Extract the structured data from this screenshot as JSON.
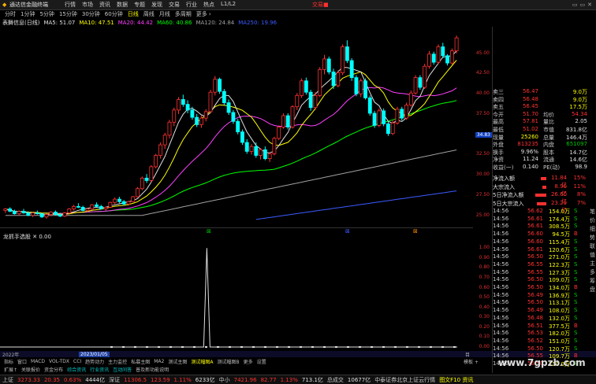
{
  "menubar": {
    "app_title": "通达信金融终端",
    "items": [
      "行情",
      "市场",
      "资讯",
      "数据",
      "专题",
      "发现",
      "交易",
      "行业",
      "热点",
      "L1/L2"
    ],
    "brand": "交易■",
    "window_controls": "▭▭✕"
  },
  "periods": {
    "items": [
      "分时",
      "1分钟",
      "5分钟",
      "15分钟",
      "30分钟",
      "60分钟",
      "日线",
      "周线",
      "月线",
      "多周期",
      "更多 ›"
    ],
    "active_index": 6
  },
  "indicators": {
    "stock_label": "表舞信息(日线)",
    "items": [
      {
        "label": "MA5: 51.07",
        "color": "#e0e0e0"
      },
      {
        "label": "MA10: 47.51",
        "color": "#ffff00"
      },
      {
        "label": "MA20: 44.42",
        "color": "#ff40ff"
      },
      {
        "label": "MA60: 40.86",
        "color": "#00ff00"
      },
      {
        "label": "MA120: 24.84",
        "color": "#a0a0a0"
      },
      {
        "label": "MA250: 19.96",
        "color": "#3b5bff"
      }
    ]
  },
  "price_axis": {
    "labels": [
      "45.00",
      "42.50",
      "40.00",
      "37.50",
      "34.83",
      "32.50",
      "30.00",
      "27.50",
      "25.00"
    ],
    "current_price": "34.83",
    "ylim": [
      24.0,
      47.5
    ]
  },
  "markers": [
    "⊠",
    "⊠",
    "⊠"
  ],
  "sub_panel": {
    "title": "龙抓手选股 ✕ 0.00",
    "axis_labels": [
      "1.00",
      "0.90",
      "0.80",
      "0.70",
      "0.60",
      "0.50",
      "0.40",
      "0.30",
      "0.20",
      "0.10",
      "0.00"
    ]
  },
  "datebar": {
    "left_date": "2022年",
    "cursor_date": "2023/01/05",
    "right": "目"
  },
  "tabs": {
    "items": [
      "指标",
      "窗口",
      "MACD",
      "VOL-TDX",
      "CCI",
      "趋势动力",
      "主力监控",
      "私募主图",
      "MA2",
      "测试主图",
      "测试幅图A",
      "测试幅图B",
      "更多",
      "设置"
    ],
    "active_index": 10,
    "right_label": "模板 +"
  },
  "tabs2": {
    "items": [
      "扩展↑",
      "关联报价",
      "资金分布",
      "综合资讯",
      "行业资讯",
      "互动问答",
      "普及新功能说明"
    ]
  },
  "statusbar": {
    "items": [
      {
        "label": "上证",
        "color": "#c8c8c8"
      },
      {
        "label": "3273.33",
        "color": "#ff3232"
      },
      {
        "label": "20.35",
        "color": "#ff3232"
      },
      {
        "label": "0.63%",
        "color": "#ff3232"
      },
      {
        "label": "4444亿",
        "color": "#e0e0e0"
      },
      {
        "label": "深证",
        "color": "#c8c8c8"
      },
      {
        "label": "11306.5",
        "color": "#ff3232"
      },
      {
        "label": "123.59",
        "color": "#ff3232"
      },
      {
        "label": "1.11%",
        "color": "#ff3232"
      },
      {
        "label": "6233亿",
        "color": "#e0e0e0"
      },
      {
        "label": "中小",
        "color": "#c8c8c8"
      },
      {
        "label": "7421.96",
        "color": "#ff3232"
      },
      {
        "label": "82.77",
        "color": "#ff3232"
      },
      {
        "label": "1.13%",
        "color": "#ff3232"
      },
      {
        "label": "713.1亿",
        "color": "#e0e0e0"
      },
      {
        "label": "总成交",
        "color": "#c8c8c8"
      },
      {
        "label": "10677亿",
        "color": "#e0e0e0"
      },
      {
        "label": "中泰证券北京上证云行情",
        "color": "#c8c8c8"
      },
      {
        "label": "图文F10 资讯",
        "color": "#ffff00"
      }
    ]
  },
  "quote": {
    "rows": [
      {
        "l": "卖三",
        "v": "56.47",
        "vc": "#ff3232",
        "l2": "",
        "v2": "9.0万",
        "v2c": "#ffff00"
      },
      {
        "l": "卖四",
        "v": "56.48",
        "vc": "#ff3232",
        "l2": "",
        "v2": "9.0万",
        "v2c": "#ffff00"
      },
      {
        "l": "卖五",
        "v": "56.45",
        "vc": "#ff3232",
        "l2": "",
        "v2": "17.5万",
        "v2c": "#ffff00"
      },
      {
        "l": "今开",
        "v": "51.70",
        "vc": "#ff3232",
        "l2": "均价",
        "v2": "54.34",
        "v2c": "#ff3232"
      },
      {
        "l": "最高",
        "v": "57.81",
        "vc": "#ff3232",
        "l2": "量比",
        "v2": "2.05",
        "v2c": "#e0e0e0"
      },
      {
        "l": "最低",
        "v": "51.02",
        "vc": "#ff3232",
        "l2": "市值",
        "v2": "831.8亿",
        "v2c": "#e0e0e0"
      },
      {
        "l": "现量",
        "v": "25260",
        "vc": "#ffff00",
        "l2": "总量",
        "v2": "146.4万",
        "v2c": "#e0e0e0"
      },
      {
        "l": "外盘",
        "v": "813235",
        "vc": "#ff3232",
        "l2": "内盘",
        "v2": "651097",
        "v2c": "#00c800"
      },
      {
        "l": "换手",
        "v": "9.96%",
        "vc": "#e0e0e0",
        "l2": "股本",
        "v2": "14.7亿",
        "v2c": "#e0e0e0"
      },
      {
        "l": "净资",
        "v": "11.24",
        "vc": "#e0e0e0",
        "l2": "流通",
        "v2": "14.6亿",
        "v2c": "#e0e0e0"
      },
      {
        "l": "收益(一)",
        "v": "0.140",
        "vc": "#e0e0e0",
        "l2": "PE(动)",
        "v2": "98.9",
        "v2c": "#e0e0e0"
      }
    ]
  },
  "flow": {
    "rows": [
      {
        "label": "净流入额",
        "value": "11.84亿",
        "pct": "15%",
        "bar": 0.35
      },
      {
        "label": "大宗流入",
        "value": "8.96亿",
        "pct": "11%",
        "bar": 0.25
      },
      {
        "label": "5日净流入额",
        "value": "26.60亿",
        "pct": "8%",
        "bar": 0.7
      },
      {
        "label": "5日大宗流入",
        "value": "23.29亿",
        "pct": "7%",
        "bar": 0.6
      }
    ]
  },
  "ticks": [
    {
      "t": "14:56",
      "p": "56.62",
      "v": "154.0万",
      "f": "S"
    },
    {
      "t": "14:56",
      "p": "56.61",
      "v": "174.4万",
      "f": "S"
    },
    {
      "t": "14:56",
      "p": "56.61",
      "v": "308.5万",
      "f": "S"
    },
    {
      "t": "14:56",
      "p": "56.60",
      "v": "94.5万",
      "f": "B"
    },
    {
      "t": "14:56",
      "p": "56.60",
      "v": "115.4万",
      "f": "S"
    },
    {
      "t": "14:56",
      "p": "56.61",
      "v": "120.6万",
      "f": "S"
    },
    {
      "t": "14:56",
      "p": "56.50",
      "v": "271.0万",
      "f": "S"
    },
    {
      "t": "14:56",
      "p": "56.55",
      "v": "122.3万",
      "f": "S"
    },
    {
      "t": "14:56",
      "p": "56.55",
      "v": "127.3万",
      "f": "S"
    },
    {
      "t": "14:56",
      "p": "56.50",
      "v": "109.0万",
      "f": "S"
    },
    {
      "t": "14:56",
      "p": "56.50",
      "v": "134.0万",
      "f": "B"
    },
    {
      "t": "14:56",
      "p": "56.49",
      "v": "136.9万",
      "f": "S"
    },
    {
      "t": "14:56",
      "p": "56.50",
      "v": "113.1万",
      "f": "S"
    },
    {
      "t": "14:56",
      "p": "56.49",
      "v": "108.0万",
      "f": "S"
    },
    {
      "t": "14:56",
      "p": "56.48",
      "v": "132.0万",
      "f": "S"
    },
    {
      "t": "14:56",
      "p": "56.51",
      "v": "377.5万",
      "f": "B"
    },
    {
      "t": "14:56",
      "p": "56.53",
      "v": "182.0万",
      "f": "S"
    },
    {
      "t": "14:56",
      "p": "56.52",
      "v": "151.0万",
      "f": "S"
    },
    {
      "t": "14:56",
      "p": "56.50",
      "v": "120.7万",
      "f": "S"
    },
    {
      "t": "14:56",
      "p": "56.55",
      "v": "109.7万",
      "f": "B"
    },
    {
      "t": "14:56",
      "p": "56.50",
      "v": "110.0万",
      "f": "S"
    }
  ],
  "sidetabs": [
    "笔",
    "价",
    "细",
    "势",
    "联",
    "值",
    "主",
    "多",
    "筹",
    "盘"
  ],
  "watermark": "www.7gpzb.com",
  "chart_data": {
    "type": "candlestick",
    "ylim": [
      24.0,
      47.5
    ],
    "candles": [
      [
        25.6,
        25.9,
        25.3,
        25.8
      ],
      [
        25.8,
        26.0,
        25.4,
        25.5
      ],
      [
        25.5,
        25.7,
        25.1,
        25.2
      ],
      [
        25.2,
        25.6,
        25.0,
        25.5
      ],
      [
        25.5,
        25.8,
        25.2,
        25.3
      ],
      [
        25.3,
        25.5,
        24.9,
        25.0
      ],
      [
        25.0,
        25.4,
        24.8,
        25.3
      ],
      [
        25.3,
        25.6,
        25.1,
        25.2
      ],
      [
        25.2,
        25.3,
        24.7,
        24.8
      ],
      [
        24.8,
        25.2,
        24.6,
        25.1
      ],
      [
        25.1,
        25.5,
        24.9,
        25.4
      ],
      [
        25.4,
        25.6,
        25.0,
        25.1
      ],
      [
        25.1,
        25.3,
        24.8,
        24.9
      ],
      [
        24.9,
        25.4,
        24.8,
        25.3
      ],
      [
        25.3,
        25.9,
        25.2,
        25.8
      ],
      [
        25.8,
        26.3,
        25.6,
        26.1
      ],
      [
        26.1,
        26.5,
        25.9,
        26.0
      ],
      [
        26.0,
        26.2,
        25.5,
        25.6
      ],
      [
        25.6,
        25.9,
        25.4,
        25.8
      ],
      [
        25.8,
        26.4,
        25.7,
        26.3
      ],
      [
        26.3,
        26.6,
        26.0,
        26.1
      ],
      [
        26.1,
        26.3,
        25.7,
        25.8
      ],
      [
        25.8,
        26.1,
        25.6,
        26.0
      ],
      [
        26.0,
        26.7,
        25.9,
        26.6
      ],
      [
        26.6,
        27.2,
        26.4,
        27.0
      ],
      [
        27.0,
        27.3,
        26.5,
        26.7
      ],
      [
        26.7,
        26.9,
        26.2,
        26.4
      ],
      [
        26.4,
        26.8,
        26.2,
        26.7
      ],
      [
        26.7,
        27.4,
        26.6,
        27.3
      ],
      [
        27.3,
        28.5,
        27.2,
        28.3
      ],
      [
        28.3,
        29.8,
        28.1,
        29.6
      ],
      [
        29.6,
        30.1,
        29.0,
        29.3
      ],
      [
        29.3,
        31.2,
        29.1,
        31.0
      ],
      [
        31.0,
        32.6,
        30.8,
        32.4
      ],
      [
        32.4,
        34.0,
        32.0,
        33.7
      ],
      [
        33.7,
        35.2,
        33.2,
        34.9
      ],
      [
        34.9,
        36.8,
        34.5,
        36.5
      ],
      [
        36.5,
        38.3,
        36.0,
        38.0
      ],
      [
        38.0,
        39.6,
        37.5,
        39.3
      ],
      [
        39.3,
        39.9,
        38.4,
        38.7
      ],
      [
        38.7,
        39.2,
        37.6,
        38.0
      ],
      [
        38.0,
        38.4,
        36.8,
        37.1
      ],
      [
        37.1,
        37.5,
        35.9,
        36.2
      ],
      [
        36.2,
        37.3,
        35.8,
        37.0
      ],
      [
        37.0,
        38.1,
        36.6,
        37.8
      ],
      [
        37.8,
        40.5,
        37.6,
        40.2
      ],
      [
        40.2,
        42.2,
        39.8,
        41.8
      ],
      [
        41.8,
        42.0,
        40.0,
        40.3
      ],
      [
        40.3,
        40.6,
        38.6,
        38.9
      ],
      [
        38.9,
        39.3,
        37.4,
        37.7
      ],
      [
        37.7,
        38.0,
        36.3,
        36.6
      ],
      [
        36.6,
        36.9,
        35.0,
        35.3
      ],
      [
        35.3,
        35.6,
        33.7,
        34.0
      ],
      [
        34.0,
        34.4,
        32.6,
        32.9
      ],
      [
        32.9,
        33.8,
        32.5,
        33.5
      ],
      [
        33.5,
        34.0,
        32.1,
        32.4
      ],
      [
        32.4,
        33.3,
        31.9,
        33.1
      ],
      [
        33.1,
        33.5,
        31.8,
        32.0
      ],
      [
        32.0,
        32.8,
        31.6,
        32.6
      ],
      [
        32.6,
        34.7,
        32.4,
        34.5
      ],
      [
        34.5,
        36.1,
        34.3,
        35.9
      ],
      [
        35.9,
        37.6,
        35.7,
        37.3
      ],
      [
        37.3,
        37.6,
        35.6,
        35.9
      ],
      [
        35.9,
        38.6,
        35.7,
        38.4
      ],
      [
        38.4,
        40.1,
        38.0,
        39.8
      ],
      [
        39.8,
        41.9,
        39.5,
        41.6
      ],
      [
        41.6,
        42.0,
        39.9,
        40.2
      ],
      [
        40.2,
        40.5,
        37.9,
        38.3
      ],
      [
        38.3,
        40.2,
        38.0,
        39.8
      ],
      [
        39.8,
        43.3,
        39.6,
        43.0
      ],
      [
        43.0,
        44.8,
        42.4,
        44.3
      ],
      [
        44.3,
        44.6,
        42.4,
        42.7
      ],
      [
        42.7,
        43.1,
        40.6,
        41.0
      ],
      [
        41.0,
        42.9,
        40.8,
        42.6
      ],
      [
        42.6,
        46.1,
        42.3,
        45.8
      ],
      [
        45.8,
        46.6,
        43.8,
        44.1
      ],
      [
        44.1,
        44.4,
        41.6,
        42.0
      ],
      [
        42.0,
        42.3,
        39.7,
        40.0
      ],
      [
        40.0,
        41.9,
        39.6,
        41.6
      ],
      [
        41.6,
        41.9,
        39.3,
        39.5
      ],
      [
        39.5,
        39.8,
        37.3,
        37.6
      ],
      [
        37.6,
        37.9,
        35.8,
        36.1
      ],
      [
        36.1,
        38.2,
        35.9,
        37.9
      ],
      [
        37.9,
        38.2,
        36.0,
        36.3
      ],
      [
        36.3,
        36.6,
        34.8,
        35.1
      ],
      [
        35.1,
        36.7,
        34.9,
        36.4
      ],
      [
        36.4,
        38.4,
        36.2,
        38.1
      ],
      [
        38.1,
        38.4,
        36.7,
        37.0
      ],
      [
        37.0,
        38.9,
        36.8,
        38.6
      ],
      [
        38.6,
        40.4,
        38.4,
        40.1
      ],
      [
        40.1,
        42.3,
        39.9,
        42.0
      ],
      [
        42.0,
        42.3,
        40.5,
        40.8
      ],
      [
        40.8,
        43.7,
        40.6,
        43.4
      ],
      [
        43.4,
        45.3,
        43.1,
        44.9
      ],
      [
        44.9,
        45.2,
        43.6,
        43.9
      ],
      [
        43.9,
        46.1,
        43.7,
        45.8
      ],
      [
        45.8,
        46.3,
        44.4,
        44.7
      ],
      [
        44.7,
        44.9,
        43.5,
        43.8
      ],
      [
        43.8,
        45.6,
        43.6,
        45.3
      ],
      [
        45.3,
        47.2,
        45.0,
        46.9
      ]
    ],
    "signal": {
      "x_ratio": 0.447,
      "value": 1.0,
      "ylim": [
        0,
        1.05
      ]
    }
  }
}
